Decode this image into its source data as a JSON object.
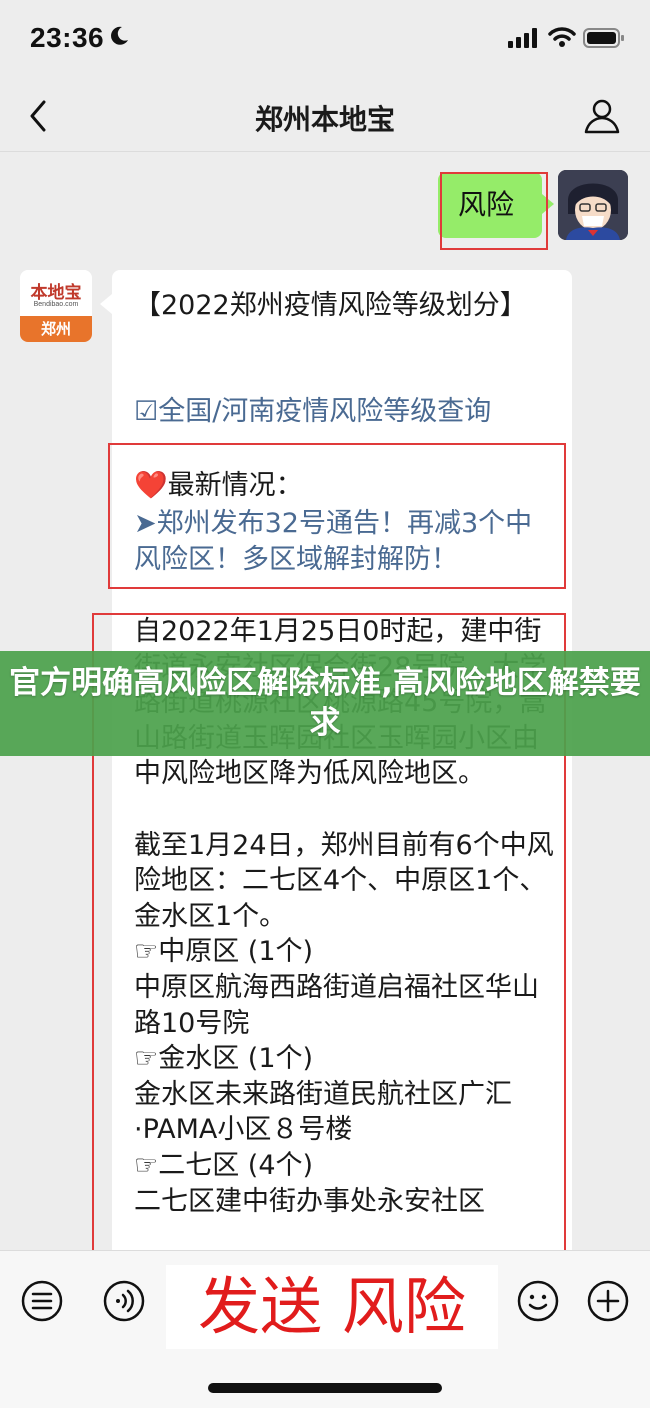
{
  "status_bar": {
    "time": "23:36"
  },
  "header": {
    "title": "郑州本地宝"
  },
  "chat": {
    "user_message": "风险",
    "bot_avatar": {
      "brand": "本地宝",
      "url": "Bendibao.com",
      "city": "郑州"
    },
    "bot_message": {
      "title": "【2022郑州疫情风险等级划分】",
      "query_link": "☑全国/河南疫情风险等级查询",
      "latest_heading": "❤️最新情况：",
      "latest_link": "➤郑州发布32号通告！再减3个中风险区！多区域解封解防！",
      "body": "自2022年1月25日0时起，建中街街道永安社区保合街28号院，大学路街道桃源社区桃源路45号院，嵩山路街道玉晖园社区玉晖园小区由中风险地区降为低风险地区。\n\n截至1月24日，郑州目前有6个中风险地区：二七区4个、中原区1个、金水区1个。\n☞中原区 (1个)\n中原区航海西路街道启福社区华山路10号院\n☞金水区 (1个)\n金水区未来路街道民航社区广汇·PAMA小区８号楼\n☞二七区 (4个)\n二七区建中街办事处永安社区"
    }
  },
  "banner": {
    "text": "官方明确高风险区解除标准,高风险地区解禁要求"
  },
  "input_bar": {
    "send_text": "发送 风险"
  },
  "colors": {
    "bubble_green": "#95ec69",
    "highlight_red": "#e03a3a",
    "banner_green": "#4ca14c",
    "link_blue": "#4a6a92"
  }
}
